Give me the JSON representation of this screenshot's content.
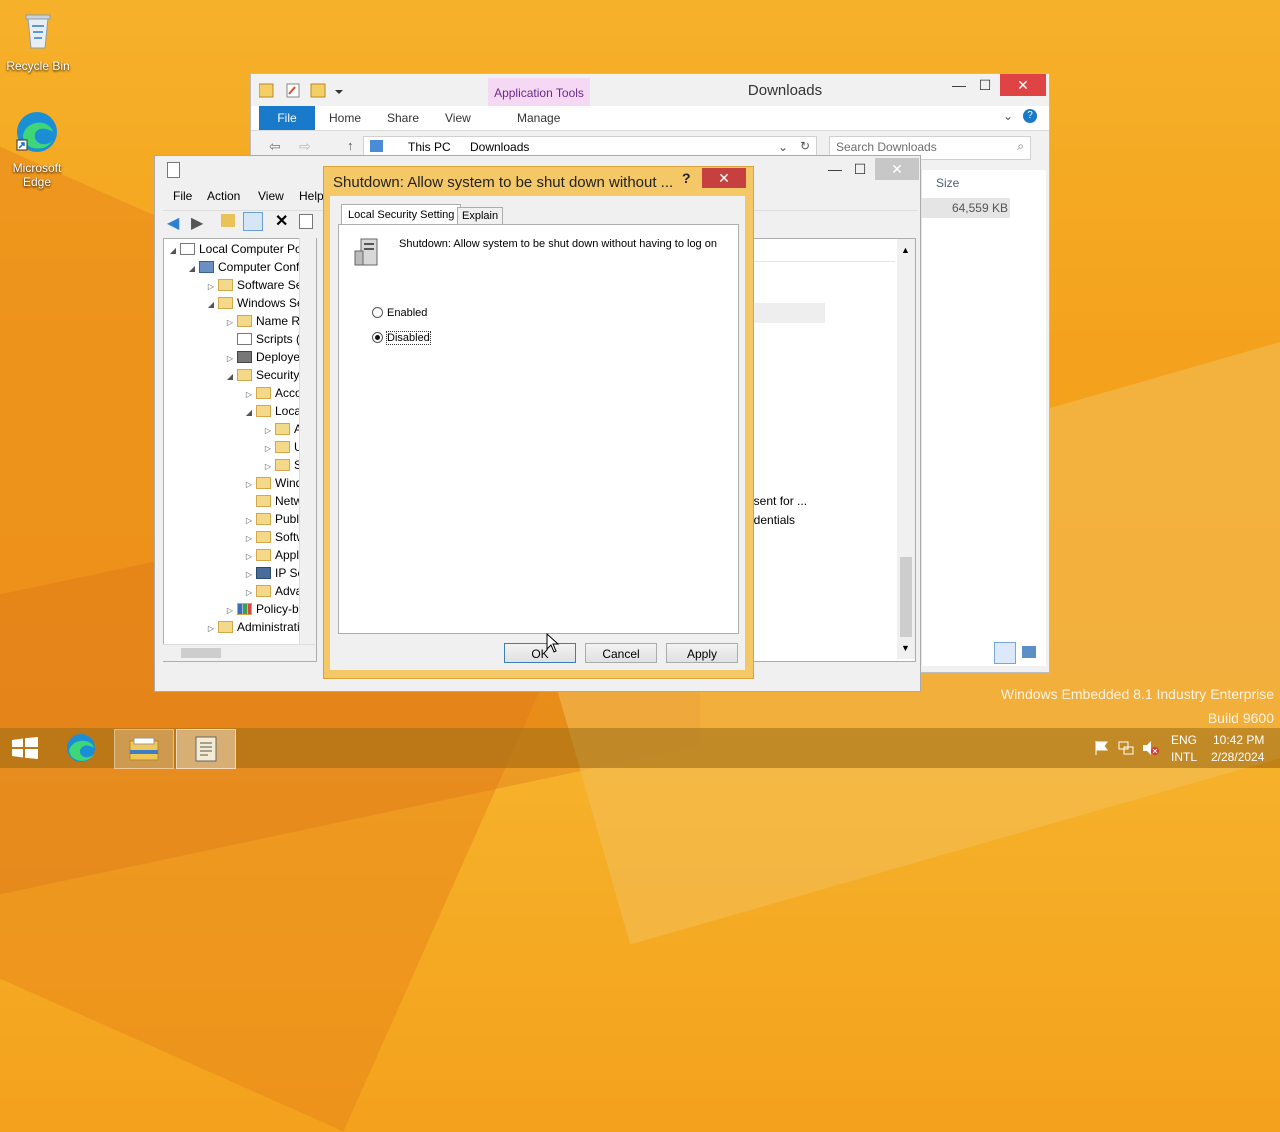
{
  "desktop": {
    "recycle_bin": "Recycle Bin",
    "edge": "Microsoft Edge",
    "watermark_line1": "Windows Embedded 8.1 Industry Enterprise",
    "watermark_line2": "Build 9600"
  },
  "explorer": {
    "title": "Downloads",
    "contextual_tab": "Application Tools",
    "ribbon_tabs": [
      "File",
      "Home",
      "Share",
      "View",
      "Manage"
    ],
    "path": [
      "This PC",
      "Downloads"
    ],
    "search_placeholder": "Search Downloads",
    "column_size": "Size",
    "file_size": "64,559 KB"
  },
  "gpe": {
    "menu": [
      "File",
      "Action",
      "View",
      "Help"
    ],
    "tree": [
      "Local Computer Polic",
      "Computer Config",
      "Software Setti",
      "Windows Sett",
      "Name Res",
      "Scripts (Sta",
      "Deployed",
      "Security Se",
      "Accou",
      "Local P",
      "Au",
      "Use",
      "Sec",
      "Windo",
      "Netwo",
      "Public",
      "Softwa",
      "Applic",
      "IP Secu",
      "Advan",
      "Policy-bas",
      "Administrative"
    ],
    "right_header_fragment": "g",
    "right_fragment_1": "nsent for ...",
    "right_fragment_2": "edentials"
  },
  "dialog": {
    "title": "Shutdown: Allow system to be shut down without ...",
    "help": "?",
    "tab_local": "Local Security Setting",
    "tab_explain": "Explain",
    "policy_name": "Shutdown: Allow system to be shut down without having to log on",
    "enabled_label": "Enabled",
    "disabled_label": "Disabled",
    "selected": "Disabled",
    "ok": "OK",
    "cancel": "Cancel",
    "apply": "Apply"
  },
  "tray": {
    "lang1": "ENG",
    "lang2": "INTL",
    "time": "10:42 PM",
    "date": "2/28/2024"
  }
}
